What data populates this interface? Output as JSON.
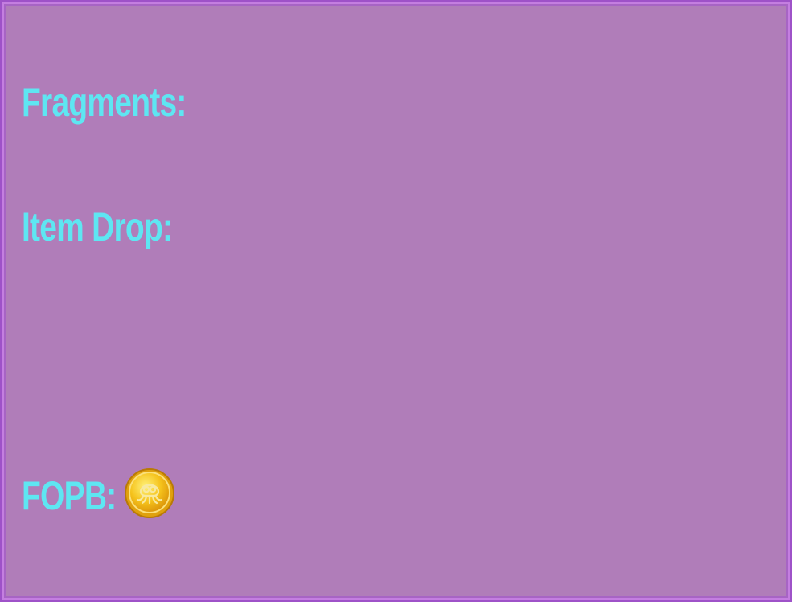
{
  "labels": {
    "fragments": "Fragments:",
    "item_drop": "Item Drop:",
    "fopb": "FOPB:"
  },
  "icons": {
    "coin": "gold-coin-icon"
  },
  "colors": {
    "background": "#b07db9",
    "border": "#9e52c8",
    "text": "#5ee6f2",
    "coin": "#f5c21b"
  }
}
